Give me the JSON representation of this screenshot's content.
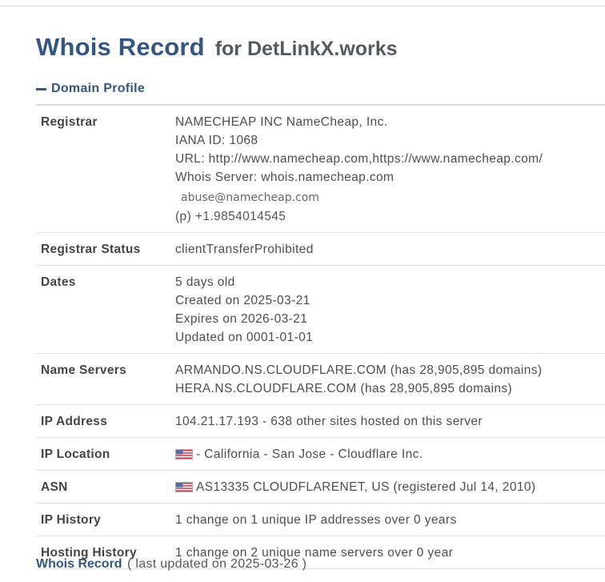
{
  "header": {
    "title_main": "Whois Record",
    "title_sub": "for DetLinkX.works"
  },
  "section": {
    "label": "Domain Profile",
    "toggle_icon": "minus-icon"
  },
  "rows": {
    "registrar": {
      "label": "Registrar",
      "name": "NAMECHEAP INC NameCheap, Inc.",
      "iana": "IANA ID: 1068",
      "url": "URL: http://www.namecheap.com,https://www.namecheap.com/",
      "whois_server": "Whois Server: whois.namecheap.com",
      "email": "abuse@namecheap.com",
      "phone_prefix": "(p)",
      "phone": "+1.9854014545"
    },
    "status": {
      "label": "Registrar Status",
      "value": "clientTransferProhibited"
    },
    "dates": {
      "label": "Dates",
      "age": "5 days old",
      "created": "Created on 2025-03-21",
      "expires": "Expires on 2026-03-21",
      "updated": "Updated on 0001-01-01"
    },
    "name_servers": {
      "label": "Name Servers",
      "ns1": "ARMANDO.NS.CLOUDFLARE.COM (has 28,905,895 domains)",
      "ns2": "HERA.NS.CLOUDFLARE.COM (has 28,905,895 domains)"
    },
    "ip_address": {
      "label": "IP Address",
      "value": "104.21.17.193 - 638 other sites hosted on this server"
    },
    "ip_location": {
      "label": "IP Location",
      "flag": "us-flag-icon",
      "value": "- California - San Jose - Cloudflare Inc."
    },
    "asn": {
      "label": "ASN",
      "flag": "us-flag-icon",
      "value": "AS13335 CLOUDFLARENET, US (registered Jul 14, 2010)"
    },
    "ip_history": {
      "label": "IP History",
      "value": "1 change on 1 unique IP addresses over 0 years"
    },
    "hosting_history": {
      "label": "Hosting History",
      "value": "1 change on 2 unique name servers over 0 year"
    }
  },
  "footer": {
    "link": "Whois Record",
    "note": "( last updated on 2025-03-26 )"
  },
  "colors": {
    "accent": "#34567f",
    "text": "#4d4d4d",
    "rule": "#e3e3e3"
  }
}
